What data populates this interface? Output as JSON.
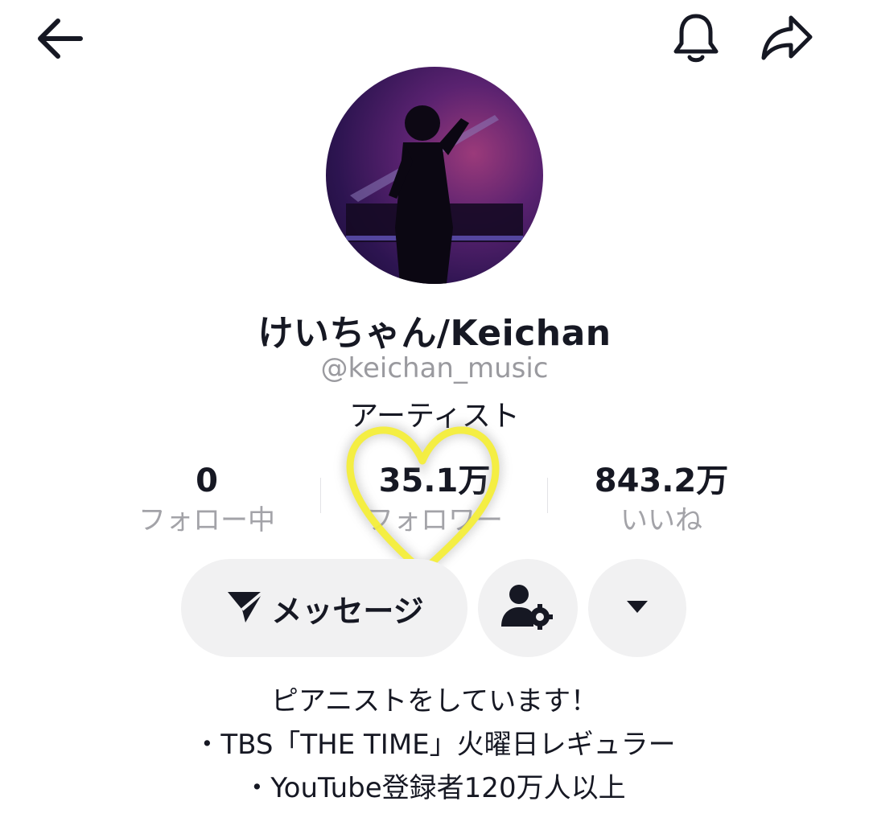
{
  "header": {
    "back_icon": "arrow-left-icon",
    "notification_icon": "bell-icon",
    "share_icon": "share-arrow-icon"
  },
  "profile": {
    "display_name": "けいちゃん/Keichan",
    "username": "@keichan_music",
    "category": "アーティスト"
  },
  "stats": {
    "following": {
      "value": "0",
      "label": "フォロー中"
    },
    "followers": {
      "value": "35.1万",
      "label": "フォロワー"
    },
    "likes": {
      "value": "843.2万",
      "label": "いいね"
    }
  },
  "actions": {
    "message_label": "メッセージ",
    "message_icon": "send-plane-icon",
    "user_settings_icon": "user-gear-icon",
    "more_icon": "caret-down-icon"
  },
  "bio": {
    "lines": [
      "ピアニストをしています！",
      "・TBS「THE TIME」火曜日レギュラー",
      "・YouTube登録者120万人以上"
    ]
  },
  "colors": {
    "text": "#161823",
    "muted": "#9a9a9f",
    "pill_bg": "#f1f1f2",
    "heart_overlay": "#f4ee3a"
  }
}
